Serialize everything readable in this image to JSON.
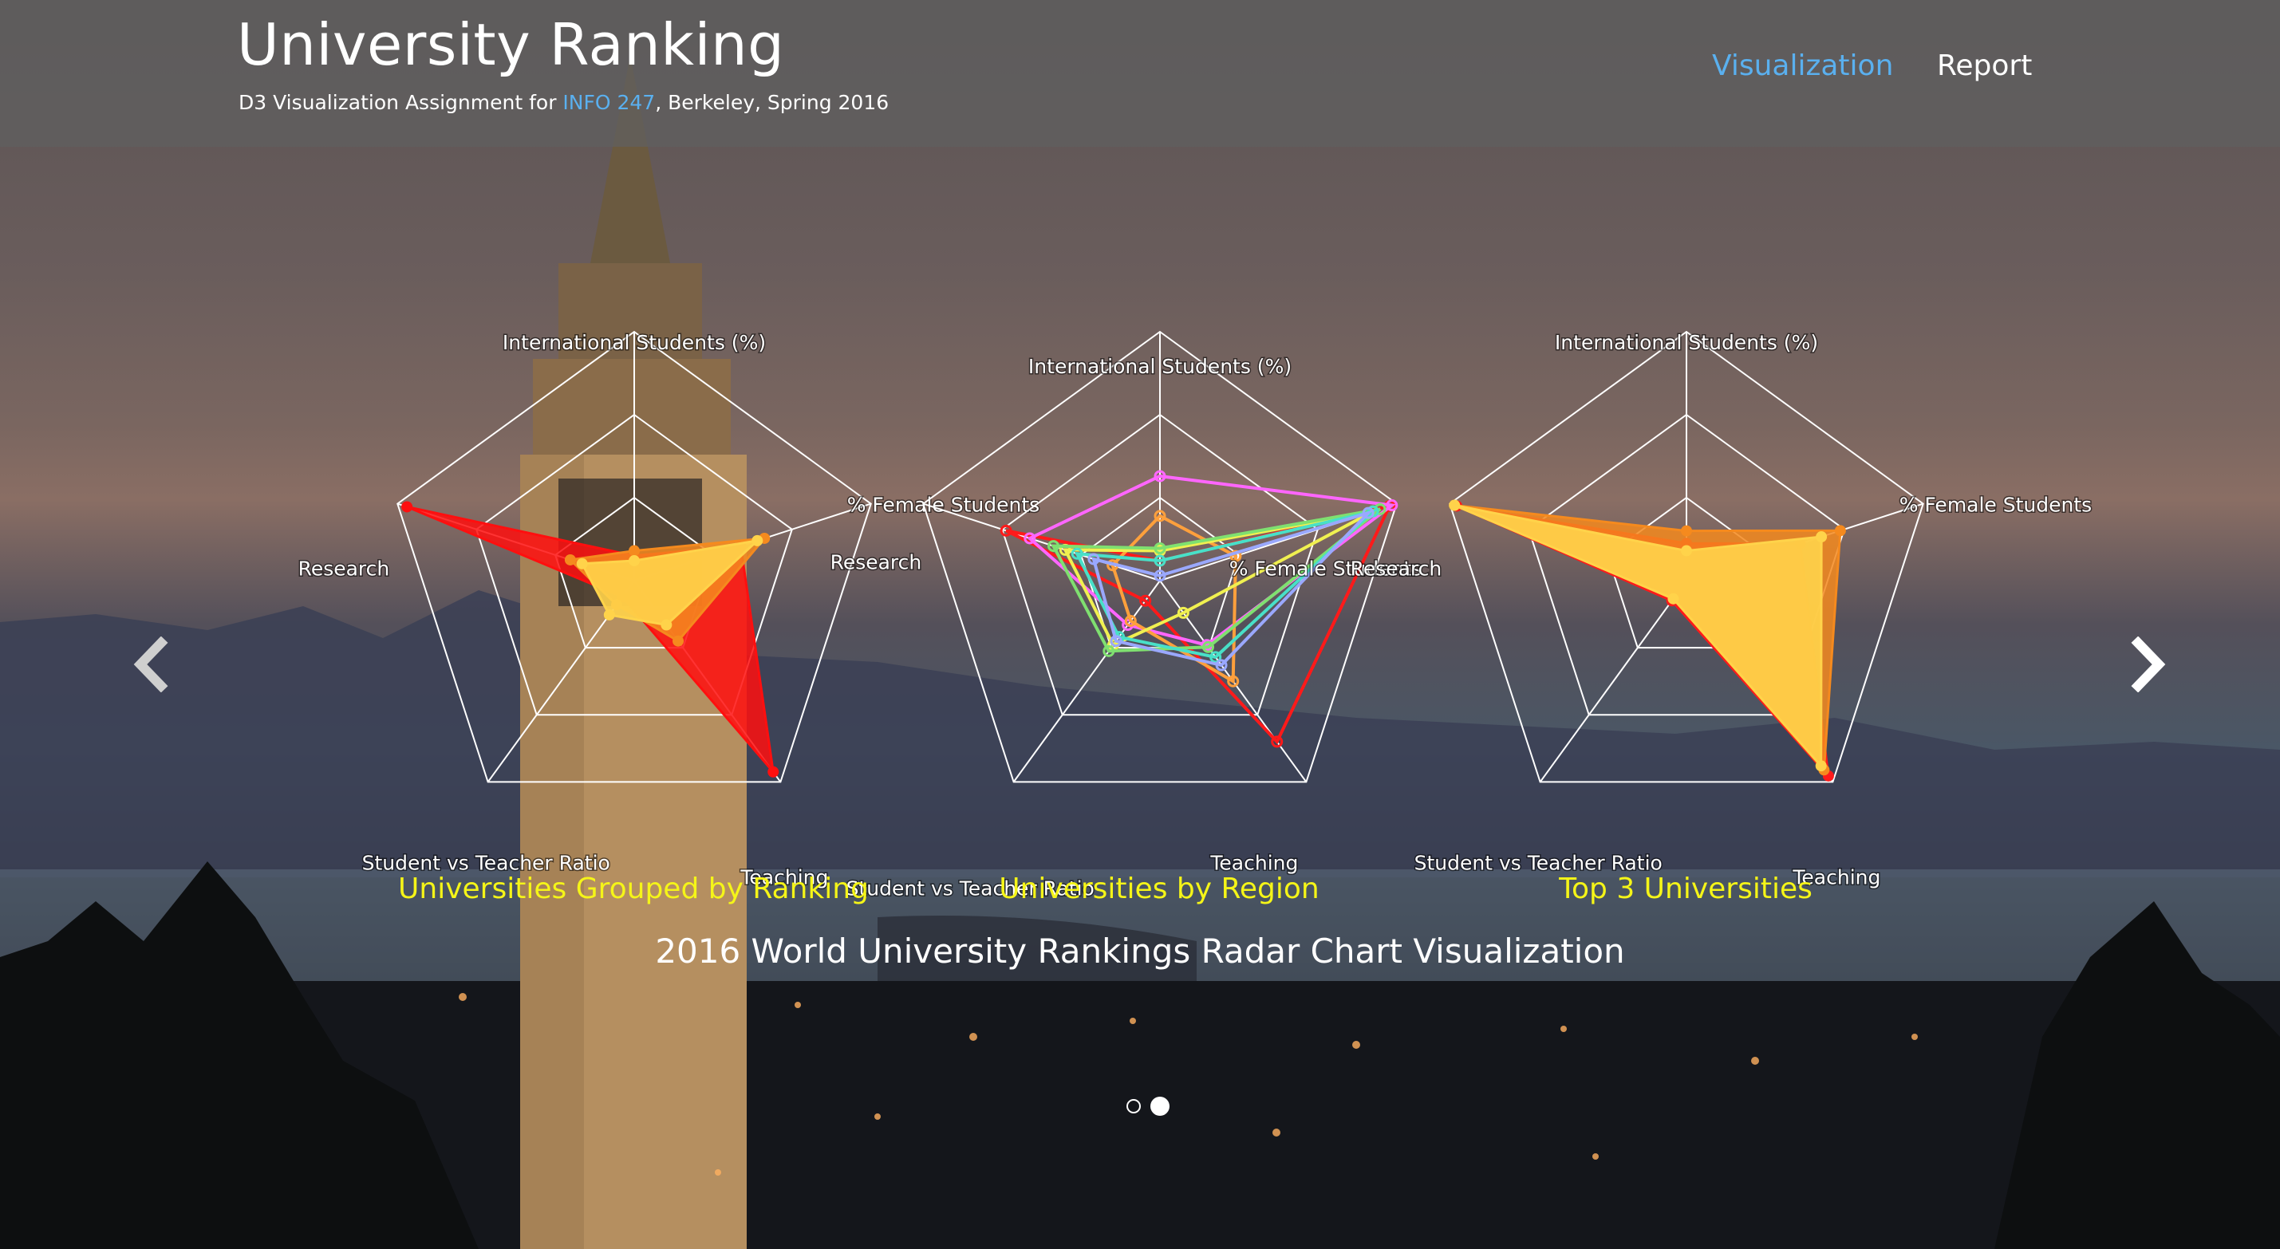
{
  "header": {
    "title": "University Ranking",
    "subtitle_prefix": "D3 Visualization Assignment for ",
    "subtitle_link": "INFO 247",
    "subtitle_suffix": ", Berkeley, Spring 2016"
  },
  "nav": {
    "items": [
      {
        "label": "Visualization",
        "active": true
      },
      {
        "label": "Report",
        "active": false
      }
    ]
  },
  "carousel": {
    "caption": "2016 World University Rankings Radar Chart Visualization",
    "prev_icon": "chevron-left-icon",
    "next_icon": "chevron-right-icon",
    "indicators": [
      {
        "active": false
      },
      {
        "active": true
      }
    ]
  },
  "colors": {
    "link_blue": "#5ab0ef",
    "chart_title_yellow": "#f5f518",
    "header_bg": "#5f5f5f"
  },
  "chart_data": [
    {
      "type": "radar",
      "title": "Universities Grouped by Ranking",
      "axes": [
        "International Students (%)",
        "% Female Students",
        "Teaching",
        "Student vs Teacher Ratio",
        "Research"
      ],
      "axis_max": 1,
      "levels": 3,
      "series": [
        {
          "color": "#ff0f0f",
          "values": [
            0.1,
            0.45,
            0.95,
            0.08,
            0.96
          ]
        },
        {
          "color": "#f58a1e",
          "values": [
            0.12,
            0.55,
            0.3,
            0.12,
            0.27
          ]
        },
        {
          "color": "#ffd34a",
          "values": [
            0.08,
            0.52,
            0.22,
            0.17,
            0.22
          ]
        }
      ]
    },
    {
      "type": "radar",
      "title": "Universities by Region",
      "axes": [
        "International Students (%)",
        "% Female Students",
        "Teaching",
        "Student vs Teacher Ratio",
        "Research"
      ],
      "axis_max": 1,
      "levels": 3,
      "series": [
        {
          "color": "#ff1a1a",
          "values": [
            0.08,
            0.97,
            0.8,
            0.1,
            0.65
          ]
        },
        {
          "color": "#ff66ff",
          "values": [
            0.42,
            0.98,
            0.32,
            0.22,
            0.55
          ]
        },
        {
          "color": "#ffa03c",
          "values": [
            0.26,
            0.32,
            0.5,
            0.2,
            0.2
          ]
        },
        {
          "color": "#f0f050",
          "values": [
            0.12,
            0.9,
            0.16,
            0.32,
            0.4
          ]
        },
        {
          "color": "#7fe070",
          "values": [
            0.13,
            0.93,
            0.33,
            0.35,
            0.45
          ]
        },
        {
          "color": "#48e0c8",
          "values": [
            0.08,
            0.9,
            0.38,
            0.28,
            0.35
          ]
        },
        {
          "color": "#9aa8ff",
          "values": [
            0.02,
            0.88,
            0.42,
            0.3,
            0.28
          ]
        }
      ]
    },
    {
      "type": "radar",
      "title": "Top 3 Universities",
      "axes": [
        "International Students (%)",
        "% Female Students",
        "Teaching",
        "Student vs Teacher Ratio",
        "Research"
      ],
      "axis_max": 1,
      "levels": 3,
      "series": [
        {
          "color": "#ff1a1a",
          "values": [
            0.15,
            0.48,
            0.97,
            0.1,
            0.97
          ]
        },
        {
          "color": "#f58a1e",
          "values": [
            0.2,
            0.65,
            0.94,
            0.09,
            0.98
          ]
        },
        {
          "color": "#ffd34a",
          "values": [
            0.12,
            0.57,
            0.92,
            0.09,
            0.98
          ]
        }
      ]
    }
  ]
}
